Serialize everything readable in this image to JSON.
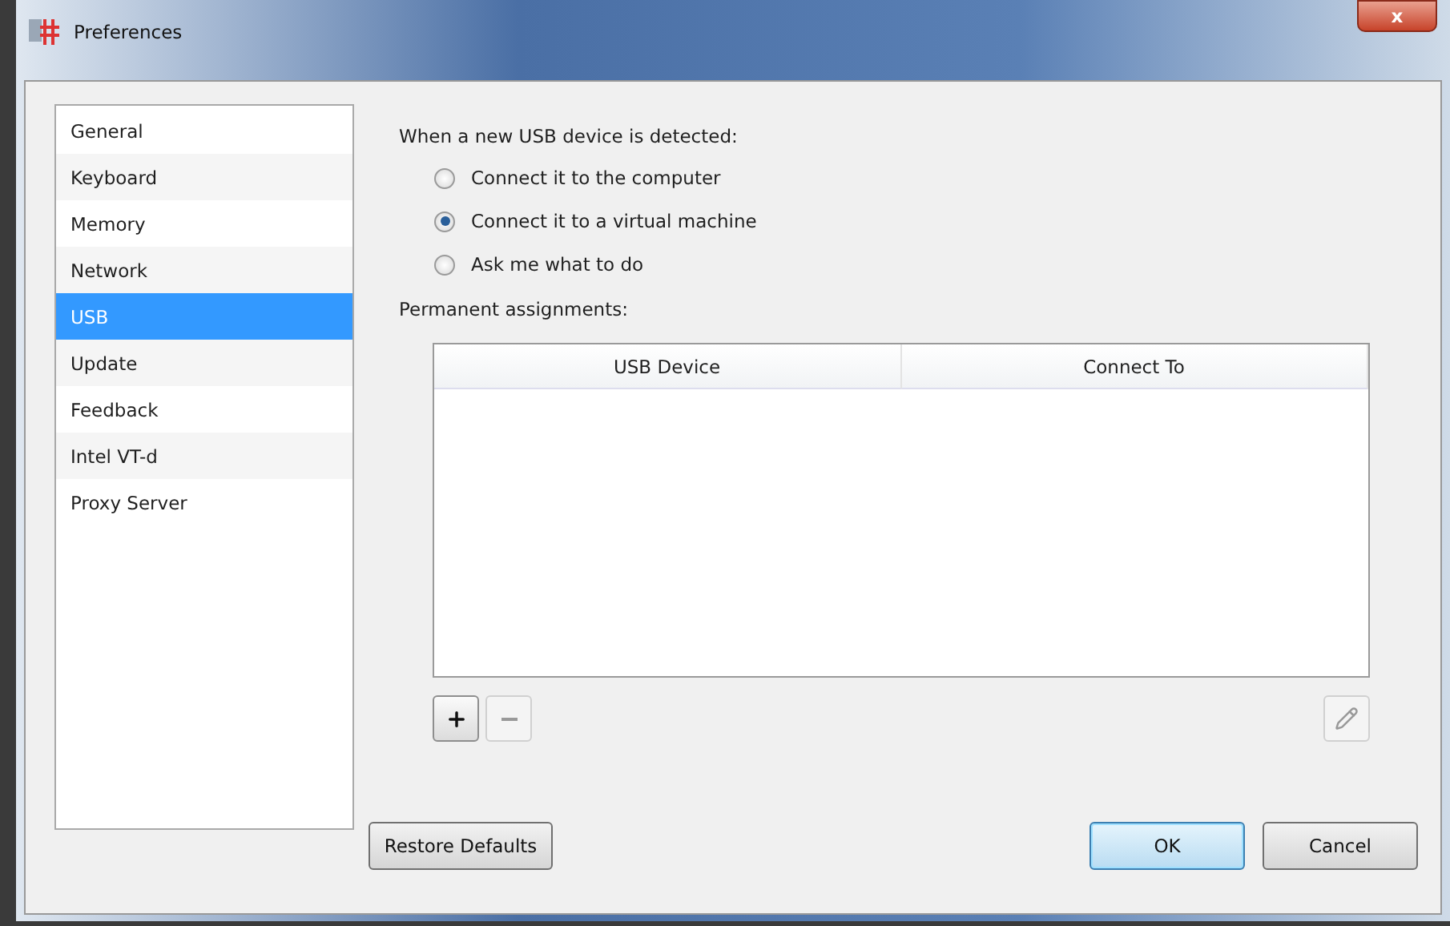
{
  "window": {
    "title": "Preferences",
    "close": "x"
  },
  "sidebar": {
    "items": [
      {
        "label": "General",
        "selected": false
      },
      {
        "label": "Keyboard",
        "selected": false
      },
      {
        "label": "Memory",
        "selected": false
      },
      {
        "label": "Network",
        "selected": false
      },
      {
        "label": "USB",
        "selected": true
      },
      {
        "label": "Update",
        "selected": false
      },
      {
        "label": "Feedback",
        "selected": false
      },
      {
        "label": "Intel VT-d",
        "selected": false
      },
      {
        "label": "Proxy Server",
        "selected": false
      }
    ]
  },
  "usb": {
    "prompt": "When a new USB device is detected:",
    "options": [
      {
        "label": "Connect it to the computer",
        "selected": false
      },
      {
        "label": "Connect it to a virtual machine",
        "selected": true
      },
      {
        "label": "Ask me what to do",
        "selected": false
      }
    ],
    "assignments_label": "Permanent assignments:",
    "table": {
      "columns": [
        "USB Device",
        "Connect To"
      ]
    },
    "remove_disabled": true
  },
  "buttons": {
    "restore": "Restore Defaults",
    "ok": "OK",
    "cancel": "Cancel"
  }
}
